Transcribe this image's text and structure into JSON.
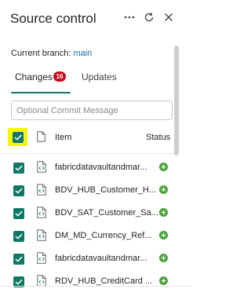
{
  "header": {
    "title": "Source control",
    "more_icon": "ellipsis-icon",
    "refresh_icon": "refresh-icon",
    "close_icon": "close-icon"
  },
  "branch": {
    "label": "Current branch:",
    "name": "main"
  },
  "tabs": [
    {
      "label": "Changes",
      "badge": "16",
      "active": true
    },
    {
      "label": "Updates",
      "active": false
    }
  ],
  "commit": {
    "placeholder": "Optional Commit Message",
    "value": ""
  },
  "table": {
    "columns": {
      "item": "Item",
      "status": "Status"
    },
    "select_all_checked": true,
    "rows": [
      {
        "name": "fabricdatavaultandmar...",
        "checked": true,
        "status": "added"
      },
      {
        "name": "BDV_HUB_Customer_H...",
        "checked": true,
        "status": "added"
      },
      {
        "name": "BDV_SAT_Customer_Sa...",
        "checked": true,
        "status": "added"
      },
      {
        "name": "DM_MD_Currency_Ref...",
        "checked": true,
        "status": "added"
      },
      {
        "name": "fabricdatavaultandmar...",
        "checked": true,
        "status": "added"
      },
      {
        "name": "RDV_HUB_CreditCard ...",
        "checked": true,
        "status": "added"
      }
    ]
  },
  "colors": {
    "accent": "#117865",
    "badge": "#c50f1f",
    "status_added": "#4aa33a",
    "branch_link": "#0f6cbd",
    "highlight": "#f7f700"
  }
}
